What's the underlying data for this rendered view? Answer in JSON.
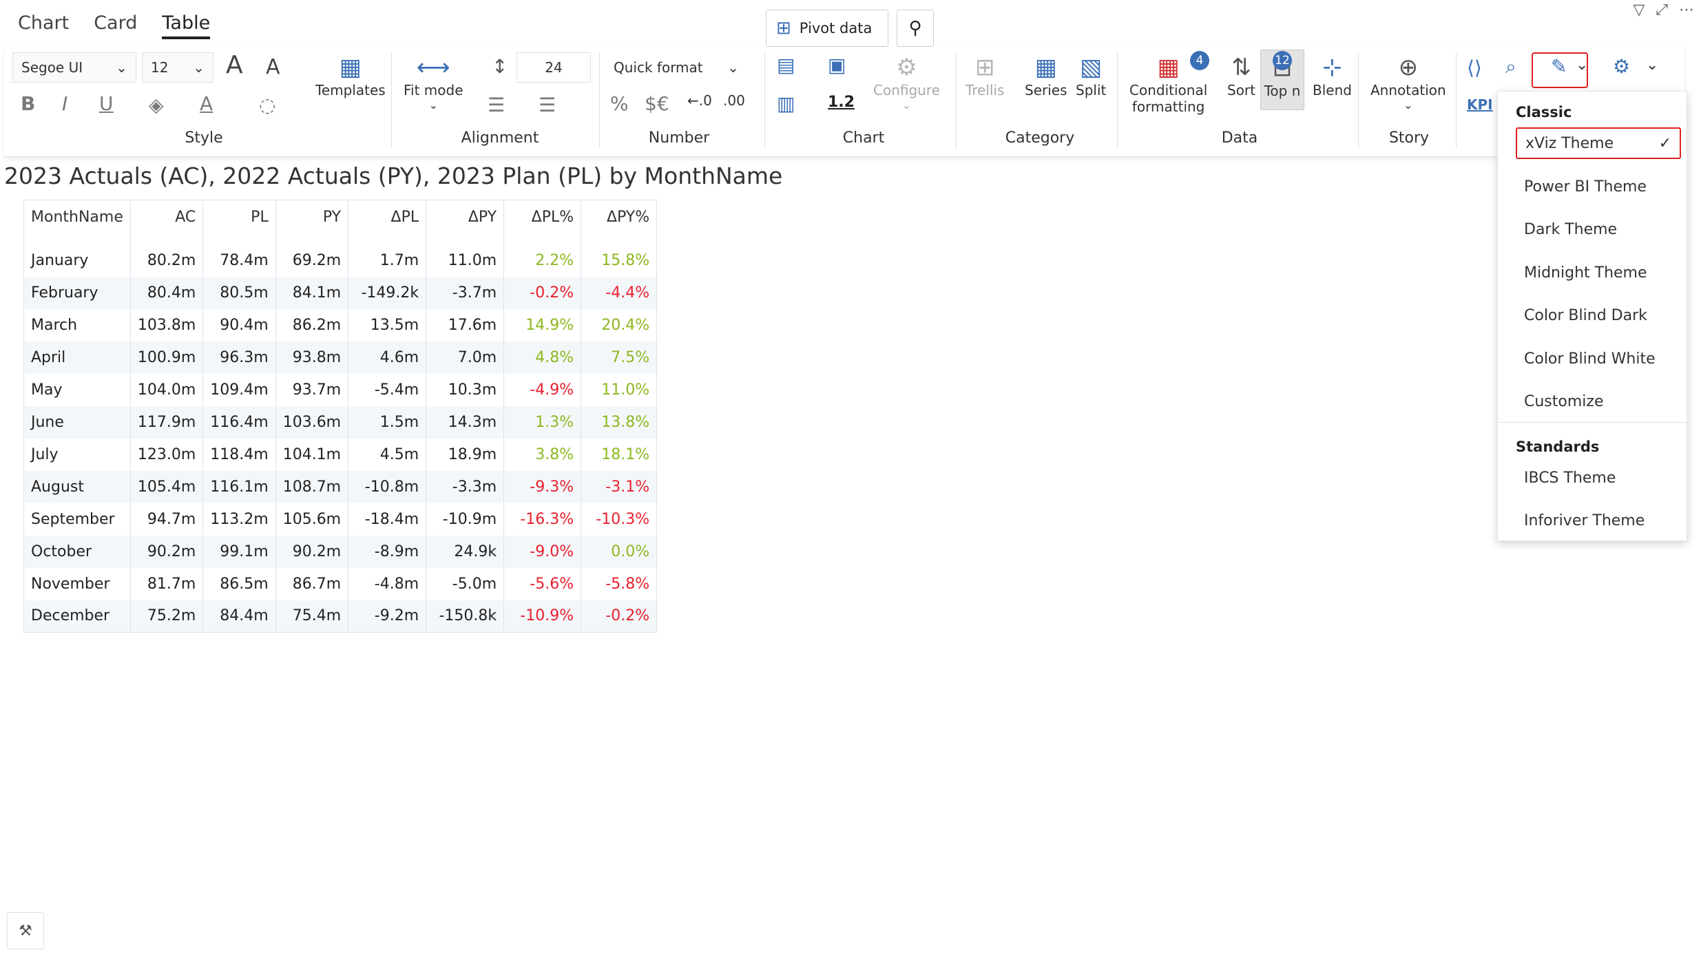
{
  "tabs": [
    {
      "label": "Chart"
    },
    {
      "label": "Card"
    },
    {
      "label": "Table",
      "active": true
    }
  ],
  "toolbar": {
    "pivot_label": "Pivot data",
    "style": {
      "font": "Segoe UI",
      "font_size": "12",
      "templates_label": "Templates",
      "group_label": "Style",
      "bold": "B",
      "italic": "I",
      "underline": "U"
    },
    "alignment": {
      "fit_mode_label": "Fit mode",
      "row_height": "24",
      "group_label": "Alignment"
    },
    "number": {
      "quick_format": "Quick format",
      "percent": "%",
      "currency": "$€",
      "group_label": "Number"
    },
    "chart": {
      "scale_value": "1.2",
      "configure_label": "Configure",
      "group_label": "Chart"
    },
    "category": {
      "trellis_label": "Trellis",
      "series_label": "Series",
      "split_label": "Split",
      "group_label": "Category"
    },
    "data": {
      "cond_format_label_1": "Conditional",
      "cond_format_label_2": "formatting",
      "cond_format_badge": "4",
      "sort_label": "Sort",
      "topn_label": "Top n",
      "topn_badge": "12",
      "blend_label": "Blend",
      "group_label": "Data"
    },
    "story": {
      "annotation_label": "Annotation",
      "group_label": "Story"
    },
    "kpi_label": "KPI"
  },
  "title": "2023 Actuals (AC), 2022 Actuals (PY), 2023 Plan (PL) by MonthName",
  "table": {
    "headers": [
      "MonthName",
      "AC",
      "PL",
      "PY",
      "ΔPL",
      "ΔPY",
      "ΔPL%",
      "ΔPY%"
    ],
    "rows": [
      {
        "name": "January",
        "ac": "80.2m",
        "pl": "78.4m",
        "py": "69.2m",
        "dpl": "1.7m",
        "dpy": "11.0m",
        "dplp": "2.2%",
        "dpyp": "15.8%"
      },
      {
        "name": "February",
        "ac": "80.4m",
        "pl": "80.5m",
        "py": "84.1m",
        "dpl": "-149.2k",
        "dpy": "-3.7m",
        "dplp": "-0.2%",
        "dpyp": "-4.4%"
      },
      {
        "name": "March",
        "ac": "103.8m",
        "pl": "90.4m",
        "py": "86.2m",
        "dpl": "13.5m",
        "dpy": "17.6m",
        "dplp": "14.9%",
        "dpyp": "20.4%"
      },
      {
        "name": "April",
        "ac": "100.9m",
        "pl": "96.3m",
        "py": "93.8m",
        "dpl": "4.6m",
        "dpy": "7.0m",
        "dplp": "4.8%",
        "dpyp": "7.5%"
      },
      {
        "name": "May",
        "ac": "104.0m",
        "pl": "109.4m",
        "py": "93.7m",
        "dpl": "-5.4m",
        "dpy": "10.3m",
        "dplp": "-4.9%",
        "dpyp": "11.0%"
      },
      {
        "name": "June",
        "ac": "117.9m",
        "pl": "116.4m",
        "py": "103.6m",
        "dpl": "1.5m",
        "dpy": "14.3m",
        "dplp": "1.3%",
        "dpyp": "13.8%"
      },
      {
        "name": "July",
        "ac": "123.0m",
        "pl": "118.4m",
        "py": "104.1m",
        "dpl": "4.5m",
        "dpy": "18.9m",
        "dplp": "3.8%",
        "dpyp": "18.1%"
      },
      {
        "name": "August",
        "ac": "105.4m",
        "pl": "116.1m",
        "py": "108.7m",
        "dpl": "-10.8m",
        "dpy": "-3.3m",
        "dplp": "-9.3%",
        "dpyp": "-3.1%"
      },
      {
        "name": "September",
        "ac": "94.7m",
        "pl": "113.2m",
        "py": "105.6m",
        "dpl": "-18.4m",
        "dpy": "-10.9m",
        "dplp": "-16.3%",
        "dpyp": "-10.3%"
      },
      {
        "name": "October",
        "ac": "90.2m",
        "pl": "99.1m",
        "py": "90.2m",
        "dpl": "-8.9m",
        "dpy": "24.9k",
        "dplp": "-9.0%",
        "dpyp": "0.0%"
      },
      {
        "name": "November",
        "ac": "81.7m",
        "pl": "86.5m",
        "py": "86.7m",
        "dpl": "-4.8m",
        "dpy": "-5.0m",
        "dplp": "-5.6%",
        "dpyp": "-5.8%"
      },
      {
        "name": "December",
        "ac": "75.2m",
        "pl": "84.4m",
        "py": "75.4m",
        "dpl": "-9.2m",
        "dpy": "-150.8k",
        "dplp": "-10.9%",
        "dpyp": "-0.2%"
      }
    ]
  },
  "colors": {
    "positive": "#8cb81f",
    "negative": "#e8202e",
    "accent": "#3b6fb6",
    "highlight_outline": "#e02020"
  },
  "theme_menu": {
    "classic_header": "Classic",
    "classic_items": [
      "xViz Theme",
      "Power BI Theme",
      "Dark Theme",
      "Midnight Theme",
      "Color Blind Dark",
      "Color Blind White",
      "Customize"
    ],
    "selected": "xViz Theme",
    "standards_header": "Standards",
    "standards_items": [
      "IBCS Theme",
      "Inforiver Theme"
    ]
  }
}
